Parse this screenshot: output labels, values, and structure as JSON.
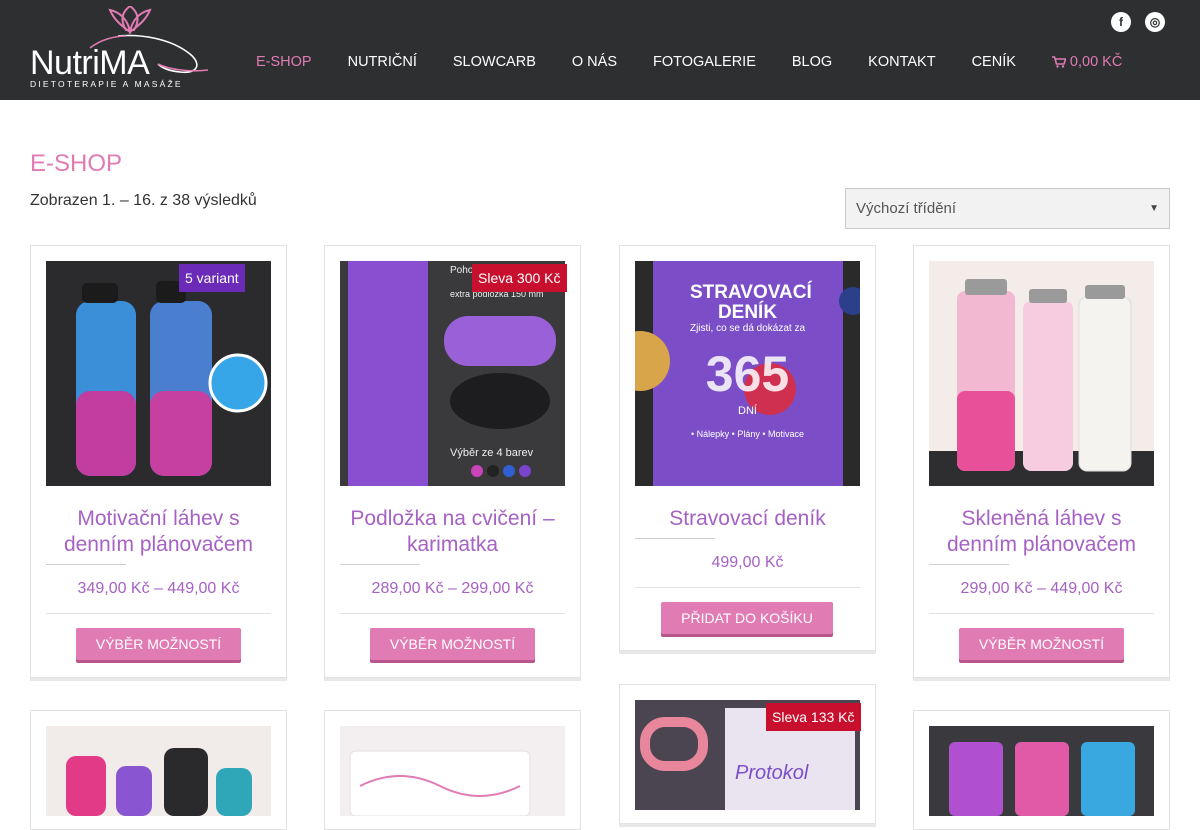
{
  "logo": {
    "brand_main": "Nutri",
    "brand_accent": "MA",
    "tagline": "DIETOTERAPIE A MASÁŽE"
  },
  "nav": {
    "items": [
      "E-SHOP",
      "NUTRIČNÍ",
      "SLOWCARB",
      "O NÁS",
      "FOTOGALERIE",
      "BLOG",
      "KONTAKT",
      "CENÍK"
    ],
    "cart_total": "0,00 KČ"
  },
  "social": {
    "facebook": "f",
    "instagram": "◎"
  },
  "page": {
    "title": "E-SHOP",
    "result_count": "Zobrazen 1. – 16. z 38 výsledků",
    "sort_label": "Výchozí třídění"
  },
  "products": [
    {
      "title": "Motivační láhev s denním plánovačem",
      "price": "349,00 Kč – 449,00 Kč",
      "button": "VÝBĚR MOŽNOSTÍ",
      "badge": "5 variant"
    },
    {
      "title": "Podložka na cvičení – karimatka",
      "price": "289,00 Kč – 299,00 Kč",
      "button": "VÝBĚR MOŽNOSTÍ",
      "badge": "Sleva 300 Kč"
    },
    {
      "title": "Stravovací deník",
      "price": "499,00 Kč",
      "button": "PŘIDAT DO KOŠÍKU",
      "badge": ""
    },
    {
      "title": "Skleněná láhev s denním plánovačem",
      "price": "299,00 Kč – 449,00 Kč",
      "button": "VÝBĚR MOŽNOSTÍ",
      "badge": ""
    }
  ],
  "second_row": {
    "sale_badge": "Sleva 133 Kč"
  },
  "image_text": {
    "mat_top": "Pohod",
    "mat_sub": "extra podložka 150 mm",
    "mat_colors": "Výběr ze 4 barev",
    "diary_title": "STRAVOVACÍ DENÍK",
    "diary_sub": "Zjisti, co se dá dokázat za",
    "diary_days": "365",
    "diary_days_label": "DNÍ",
    "diary_features": "• Nálepky • Plány • Motivace",
    "protocol": "Protokol"
  },
  "colors": {
    "accent": "#e07bb4",
    "title_purple": "#a661c4",
    "header_bg": "#2d2f31",
    "variant_badge": "#6b2ab8",
    "sale_badge": "#c8102e"
  }
}
